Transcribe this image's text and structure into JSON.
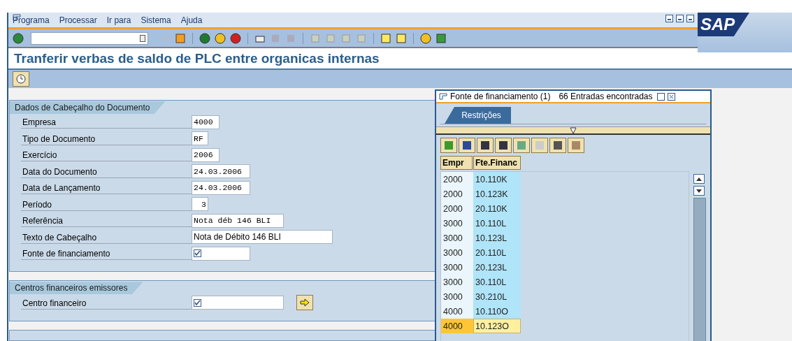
{
  "menu": [
    {
      "label": "Programa"
    },
    {
      "label": "Processar"
    },
    {
      "label": "Ir para"
    },
    {
      "label": "Sistema"
    },
    {
      "label": "Ajuda"
    }
  ],
  "logo": "SAP",
  "screen_title": "Tranferir verbas de saldo de PLC entre organicas internas",
  "groups": [
    {
      "title": "Dados de Cabeçalho do Documento",
      "fields": [
        {
          "label": "Empresa",
          "value": "4000",
          "kind": "mono"
        },
        {
          "label": "Tipo de Documento",
          "value": "RF",
          "kind": "mono"
        },
        {
          "label": "Exercício",
          "value": "2006",
          "kind": "mono"
        },
        {
          "label": "Data do Documento",
          "value": "24.03.2006",
          "kind": "mono"
        },
        {
          "label": "Data de Lançamento",
          "value": "24.03.2006",
          "kind": "mono"
        },
        {
          "label": "Período",
          "value": "3",
          "kind": "mono"
        },
        {
          "label": "Referência",
          "value": "Nota déb 146 BLI",
          "kind": "mono"
        },
        {
          "label": "Texto de Cabeçalho",
          "value": "Nota de Débito 146 BLI",
          "kind": "text"
        },
        {
          "label": "Fonte de financiamento",
          "kind": "required"
        }
      ]
    },
    {
      "title": "Centros financeiros emissores",
      "fields": [
        {
          "label": "Centro financeiro",
          "kind": "required"
        }
      ]
    }
  ],
  "popup": {
    "title": "Fonte de financiamento (1)",
    "count": "66 Entradas encontradas",
    "tabs": [
      {
        "label": "Restrições",
        "selected": true
      }
    ],
    "columns": [
      "Empr",
      "Fte.Financ"
    ],
    "rows": [
      {
        "cells": [
          "2000",
          "10.110K"
        ],
        "selected": false
      },
      {
        "cells": [
          "2000",
          "10.123K"
        ],
        "selected": false
      },
      {
        "cells": [
          "2000",
          "20.110K"
        ],
        "selected": false
      },
      {
        "cells": [
          "3000",
          "10.110L"
        ],
        "selected": false
      },
      {
        "cells": [
          "3000",
          "10.123L"
        ],
        "selected": false
      },
      {
        "cells": [
          "3000",
          "20.110L"
        ],
        "selected": false
      },
      {
        "cells": [
          "3000",
          "20.123L"
        ],
        "selected": false
      },
      {
        "cells": [
          "3000",
          "30.110L"
        ],
        "selected": false
      },
      {
        "cells": [
          "3000",
          "30.210L"
        ],
        "selected": false
      },
      {
        "cells": [
          "4000",
          "10.110O"
        ],
        "selected": false
      },
      {
        "cells": [
          "4000",
          "10.123O"
        ],
        "selected": true
      }
    ]
  }
}
